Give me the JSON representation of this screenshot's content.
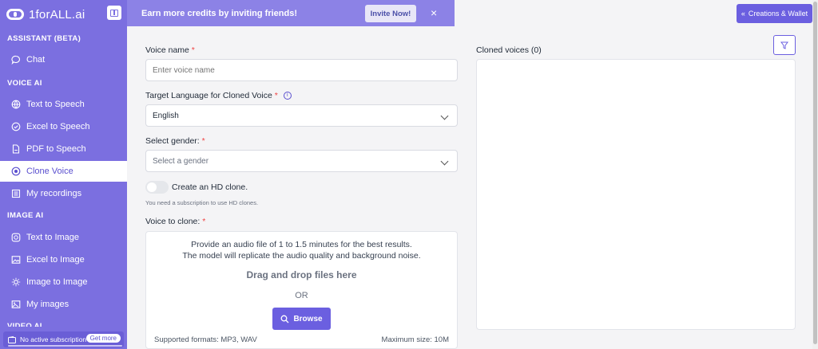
{
  "brand": {
    "name": "1forALL.ai"
  },
  "sidebar": {
    "sections": [
      {
        "title": "ASSISTANT (BETA)",
        "items": [
          {
            "label": "Chat",
            "icon": "chat-icon"
          }
        ]
      },
      {
        "title": "VOICE AI",
        "items": [
          {
            "label": "Text to Speech",
            "icon": "globe-icon"
          },
          {
            "label": "Excel to Speech",
            "icon": "check-circle-icon"
          },
          {
            "label": "PDF to Speech",
            "icon": "file-icon"
          },
          {
            "label": "Clone Voice",
            "icon": "record-icon",
            "active": true
          },
          {
            "label": "My recordings",
            "icon": "list-icon"
          }
        ]
      },
      {
        "title": "IMAGE AI",
        "items": [
          {
            "label": "Text to Image",
            "icon": "camera-icon"
          },
          {
            "label": "Excel to Image",
            "icon": "image-icon"
          },
          {
            "label": "Image to Image",
            "icon": "sun-icon"
          },
          {
            "label": "My images",
            "icon": "gallery-icon"
          }
        ]
      },
      {
        "title": "VIDEO AI",
        "items": []
      }
    ],
    "subscription": {
      "text": "No active subscription",
      "button": "Get more"
    }
  },
  "banner": {
    "text": "Earn more credits by inviting friends!",
    "button": "Invite Now!",
    "close": "×"
  },
  "header": {
    "wallet_button": "Creations & Wallet",
    "wallet_chevron": "«"
  },
  "form": {
    "voice_name": {
      "label": "Voice name",
      "required": "*",
      "placeholder": "Enter voice name"
    },
    "language": {
      "label": "Target Language for Cloned Voice",
      "required": "*",
      "value": "English"
    },
    "gender": {
      "label": "Select gender:",
      "required": "*",
      "value": "Select a gender"
    },
    "hd_clone": {
      "label": "Create an HD clone.",
      "hint": "You need a subscription to use HD clones.",
      "enabled": false
    },
    "voice_to_clone": {
      "label": "Voice to clone:",
      "required": "*",
      "line1": "Provide an audio file of 1 to 1.5 minutes for the best results.",
      "line2": "The model will replicate the audio quality and background noise.",
      "drag_text": "Drag and drop files here",
      "or_text": "OR",
      "browse_label": "Browse",
      "formats": "Supported formats: MP3, WAV",
      "max_size": "Maximum size: 10M"
    }
  },
  "cloned": {
    "label": "Cloned voices (0)"
  },
  "colors": {
    "accent": "#6b5fe0",
    "sidebar": "#7b6fe0",
    "banner": "#8c82e6"
  }
}
